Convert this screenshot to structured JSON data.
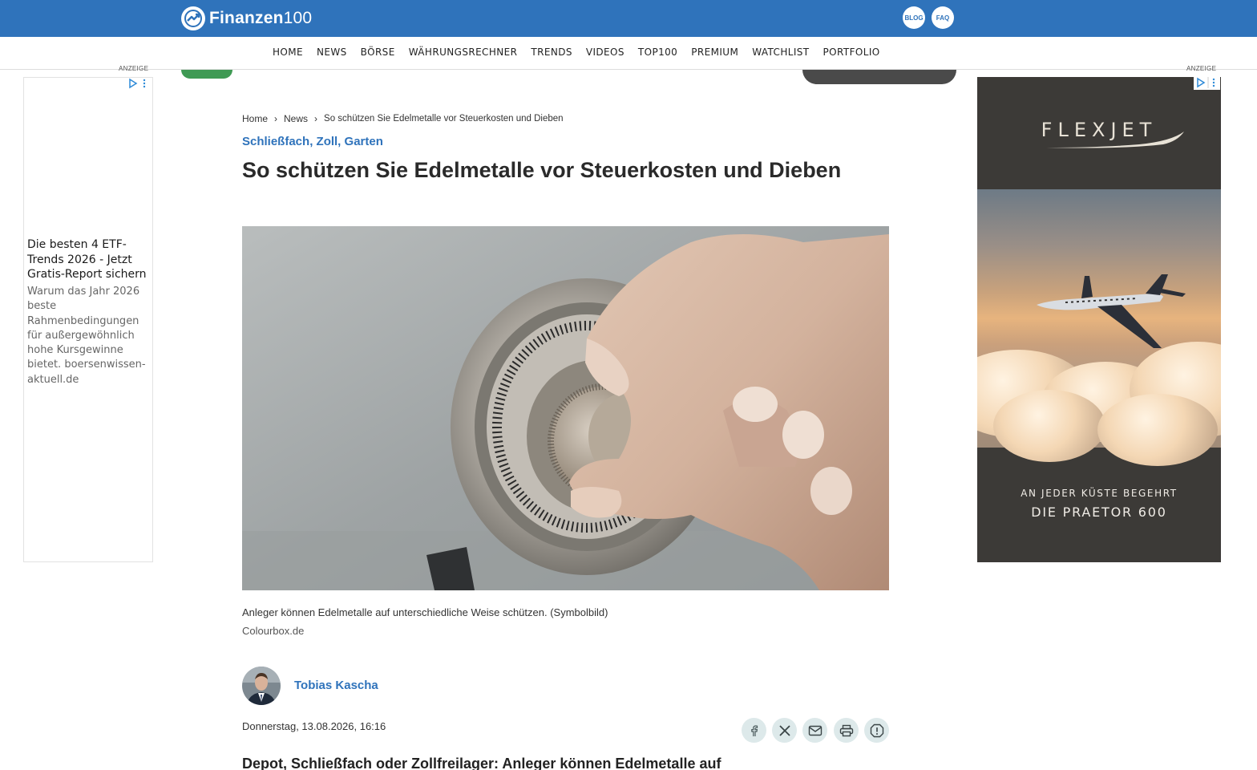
{
  "header": {
    "logo_bold": "Finanzen",
    "logo_num": "100",
    "blog_label": "BLOG",
    "faq_label": "FAQ"
  },
  "nav": {
    "items": [
      "HOME",
      "NEWS",
      "BÖRSE",
      "WÄHRUNGSRECHNER",
      "TRENDS",
      "VIDEOS",
      "TOP100",
      "PREMIUM",
      "WATCHLIST",
      "PORTFOLIO"
    ]
  },
  "ads": {
    "anzeige_label": "ANZEIGE",
    "left": {
      "title": "Die besten 4 ETF-Trends 2026 - Jetzt Gratis-Report sichern",
      "body": "Warum das Jahr 2026 beste Rahmenbedingungen für außergewöhnlich hohe Kursgewinne bietet. boersenwissen-aktuell.de"
    },
    "right": {
      "brand": "FLEXJET",
      "tagline": "AN JEDER KÜSTE BEGEHRT",
      "product": "DIE PRAETOR 600"
    }
  },
  "article": {
    "breadcrumb": [
      "Home",
      "News",
      "So schützen Sie Edelmetalle vor Steuerkosten und Dieben"
    ],
    "kicker": "Schließfach, Zoll, Garten",
    "headline": "So schützen Sie Edelmetalle vor Steuerkosten und Dieben",
    "caption": "Anleger können Edelmetalle auf unterschiedliche Weise schützen. (Symbolbild)",
    "credit": "Colourbox.de",
    "author": "Tobias Kascha",
    "date": "Donnerstag, 13.08.2026, 16:16",
    "lead": "Depot, Schließfach oder Zollfreilager: Anleger können Edelmetalle auf"
  },
  "share_icons": [
    "facebook-icon",
    "x-icon",
    "mail-icon",
    "print-icon",
    "report-icon"
  ],
  "colors": {
    "brand_blue": "#2f73bb",
    "share_bg": "#dde9ea",
    "ad_dark": "#3c3a37"
  }
}
